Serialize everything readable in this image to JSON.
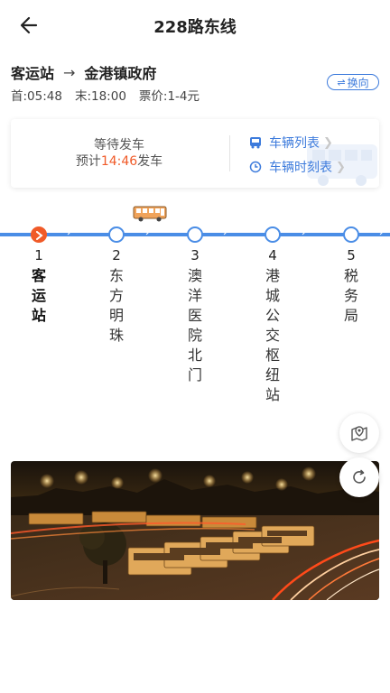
{
  "header": {
    "title": "228路东线",
    "back_icon": "back-arrow-icon"
  },
  "route": {
    "from": "客运站",
    "arrow": "→",
    "to": "金港镇政府"
  },
  "switch_button": {
    "icon": "⇌",
    "label": "换向"
  },
  "schedule": {
    "first": "首:05:48",
    "last": "末:18:00",
    "fare": "票价:1-4元"
  },
  "status_card": {
    "status": "等待发车",
    "eta_prefix": "预计",
    "eta_time": "14:46",
    "eta_suffix": "发车",
    "links": [
      {
        "label": "车辆列表",
        "icon": "bus-icon"
      },
      {
        "label": "车辆时刻表",
        "icon": "clock-icon"
      }
    ]
  },
  "stops": [
    {
      "num": "1",
      "name": "客运站",
      "current": true
    },
    {
      "num": "2",
      "name": "东方明珠",
      "current": false
    },
    {
      "num": "3",
      "name": "澳洋医院北门",
      "current": false
    },
    {
      "num": "4",
      "name": "港城公交枢纽站",
      "current": false
    },
    {
      "num": "5",
      "name": "税务局",
      "current": false
    }
  ],
  "floating_buttons": [
    "map-pin-icon",
    "refresh-icon"
  ],
  "colors": {
    "accent": "#3d7bdc",
    "track": "#4a8de6",
    "current": "#f05a28"
  }
}
